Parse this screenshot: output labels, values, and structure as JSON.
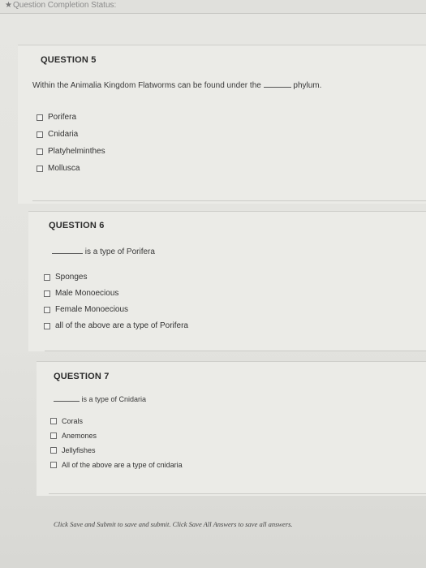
{
  "status": {
    "label": "Question Completion Status:",
    "icon": "star-icon"
  },
  "questions": [
    {
      "title": "QUESTION 5",
      "text_before": "Within the Animalia Kingdom Flatworms can be found under the",
      "text_after": "phylum.",
      "options": [
        "Porifera",
        "Cnidaria",
        "Platyhelminthes",
        "Mollusca"
      ]
    },
    {
      "title": "QUESTION 6",
      "text_after": "is a type of Porifera",
      "options": [
        "Sponges",
        "Male Monoecious",
        "Female Monoecious",
        "all of the above are a type of Porifera"
      ]
    },
    {
      "title": "QUESTION 7",
      "text_after": "is a type of Cnidaria",
      "options": [
        "Corals",
        "Anemones",
        "Jellyfishes",
        "All of the above are a type of cnidaria"
      ]
    }
  ],
  "footer": {
    "text": "Click Save and Submit to save and submit. Click Save All Answers to save all answers."
  }
}
